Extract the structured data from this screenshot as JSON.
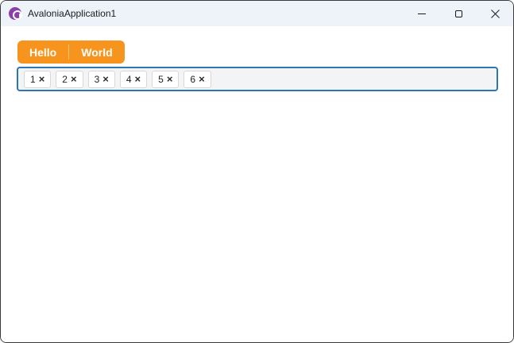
{
  "window": {
    "title": "AvaloniaApplication1"
  },
  "titlebar": {
    "icons": {
      "app": "avalonia-logo",
      "minimize": "minimize-icon",
      "maximize": "maximize-icon",
      "close": "close-icon"
    }
  },
  "tabstrip": {
    "items": [
      {
        "label": "Hello"
      },
      {
        "label": "World"
      }
    ]
  },
  "chipbox": {
    "remove_glyph": "×",
    "items": [
      {
        "label": "1"
      },
      {
        "label": "2"
      },
      {
        "label": "3"
      },
      {
        "label": "4"
      },
      {
        "label": "5"
      },
      {
        "label": "6"
      }
    ]
  },
  "colors": {
    "accent_orange": "#f7941d",
    "focus_border": "#2e75b6",
    "titlebar_bg": "#eef3fa",
    "avalonia_purple": "#8b3fa8",
    "chip_bg": "#ffffff",
    "chipbox_bg": "#f2f4f6"
  }
}
